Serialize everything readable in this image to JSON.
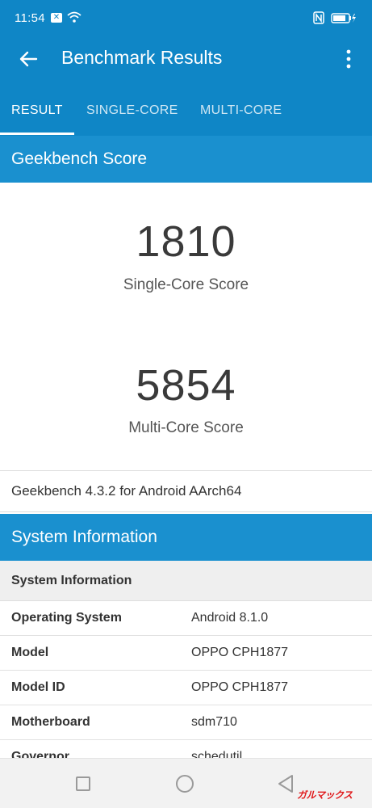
{
  "status_bar": {
    "time": "11:54",
    "icons": [
      "mail-notification-icon",
      "wifi-icon",
      "nfc-icon",
      "battery-charging-icon"
    ]
  },
  "app_bar": {
    "title": "Benchmark Results",
    "back_icon": "arrow-back-icon",
    "menu_icon": "more-vert-icon"
  },
  "tabs": [
    {
      "label": "RESULT",
      "active": true
    },
    {
      "label": "SINGLE-CORE",
      "active": false
    },
    {
      "label": "MULTI-CORE",
      "active": false
    }
  ],
  "geekbench": {
    "section_title": "Geekbench Score",
    "single_core": {
      "score": "1810",
      "label": "Single-Core Score"
    },
    "multi_core": {
      "score": "5854",
      "label": "Multi-Core Score"
    },
    "version": "Geekbench 4.3.2 for Android AArch64"
  },
  "system_information": {
    "section_title": "System Information",
    "subheader": "System Information",
    "rows": [
      {
        "key": "Operating System",
        "value": "Android 8.1.0"
      },
      {
        "key": "Model",
        "value": "OPPO CPH1877"
      },
      {
        "key": "Model ID",
        "value": "OPPO CPH1877"
      },
      {
        "key": "Motherboard",
        "value": "sdm710"
      },
      {
        "key": "Governor",
        "value": "schedutil"
      }
    ]
  },
  "nav_bar": {
    "icons": [
      "recents-square-icon",
      "home-circle-icon",
      "back-triangle-icon"
    ]
  },
  "watermark": "ガルマックス",
  "colors": {
    "primary": "#0f86c6",
    "section": "#1a90cf",
    "subheader_bg": "#efefef"
  }
}
